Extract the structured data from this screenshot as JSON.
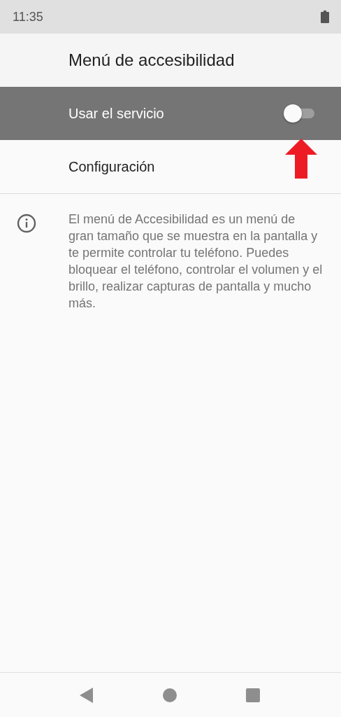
{
  "status_bar": {
    "time": "11:35"
  },
  "title": "Menú de accesibilidad",
  "items": [
    {
      "kind": "switch",
      "label": "Usar el servicio",
      "highlighted": true,
      "on": false
    },
    {
      "kind": "link",
      "label": "Configuración",
      "highlighted": false
    }
  ],
  "info": "El menú de Accesibilidad es un menú de gran tamaño que se muestra en la pantalla y te permite controlar tu teléfono. Puedes bloquear el teléfono, controlar el volumen y el brillo, realizar capturas de pantalla y mucho más."
}
